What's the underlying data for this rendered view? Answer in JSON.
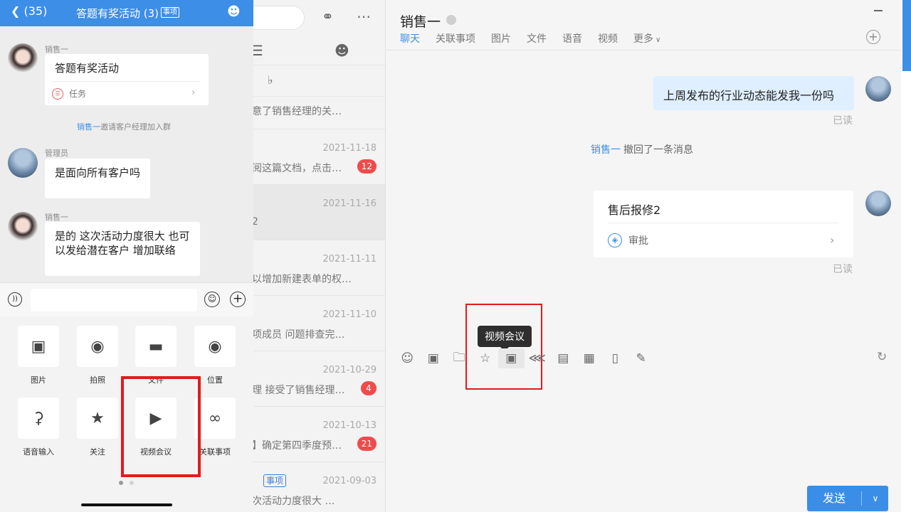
{
  "phone": {
    "nav": {
      "back_count": "(35)",
      "title": "答题有奖活动 (3)",
      "tag": "事项"
    },
    "messages": [
      {
        "sender": "销售一",
        "text": "答题有奖活动",
        "card_type": "任务"
      },
      {
        "sender": "管理员",
        "text": "是面向所有客户吗"
      },
      {
        "sender": "销售一",
        "text": "是的 这次活动力度很大 也可以发给潜在客户 增加联络"
      }
    ],
    "system_notice": {
      "name": "销售一",
      "text": "邀请客户经理加入群"
    },
    "input_placeholder": "",
    "grid": [
      {
        "label": "图片",
        "icon": "image-icon"
      },
      {
        "label": "拍照",
        "icon": "camera-icon"
      },
      {
        "label": "文件",
        "icon": "folder-icon"
      },
      {
        "label": "位置",
        "icon": "location-icon"
      },
      {
        "label": "语音输入",
        "icon": "mic-icon"
      },
      {
        "label": "关注",
        "icon": "star-icon"
      },
      {
        "label": "视频会议",
        "icon": "video-icon"
      },
      {
        "label": "关联事项",
        "icon": "link-icon"
      }
    ]
  },
  "conv_list": {
    "items": [
      {
        "date": "",
        "snippet": "意了销售经理的关…",
        "badge": ""
      },
      {
        "date": "2021-11-18",
        "snippet": "阅这篇文档，点击…",
        "badge": "12"
      },
      {
        "date": "2021-11-16",
        "snippet": "2",
        "badge": ""
      },
      {
        "date": "2021-11-11",
        "snippet": "以增加新建表单的权…",
        "badge": ""
      },
      {
        "date": "2021-11-10",
        "snippet": "项成员 问题排查完…",
        "badge": ""
      },
      {
        "date": "2021-10-29",
        "snippet": "理 接受了销售经理…",
        "badge": "4"
      },
      {
        "date": "2021-10-13",
        "snippet": "】确定第四季度预…",
        "badge": "21"
      },
      {
        "date": "2021-09-03",
        "snippet": "次活动力度很大 …",
        "badge": "",
        "tag": "事项"
      }
    ]
  },
  "chat": {
    "title": "销售一",
    "tabs": [
      "聊天",
      "关联事项",
      "图片",
      "文件",
      "语音",
      "视频",
      "更多"
    ],
    "active_tab": "聊天",
    "messages": {
      "outgoing_text": "上周发布的行业动态能发我一份吗",
      "read_label": "已读",
      "recall_name": "销售一",
      "recall_text": "撤回了一条消息",
      "card_title": "售后报修2",
      "card_type": "审批",
      "card_read_label": "已读"
    },
    "tooltip": "视频会议",
    "toolbar_icons": [
      "emoji-icon",
      "screenshot-icon",
      "folder-icon",
      "star-icon",
      "video-icon",
      "share-icon",
      "doc-icon",
      "contact-card-icon",
      "shake-icon",
      "eraser-icon"
    ],
    "send_label": "发送"
  },
  "colors": {
    "accent": "#3d8ee6",
    "badge": "#f04b4b",
    "highlight_box": "#e21b1b"
  }
}
